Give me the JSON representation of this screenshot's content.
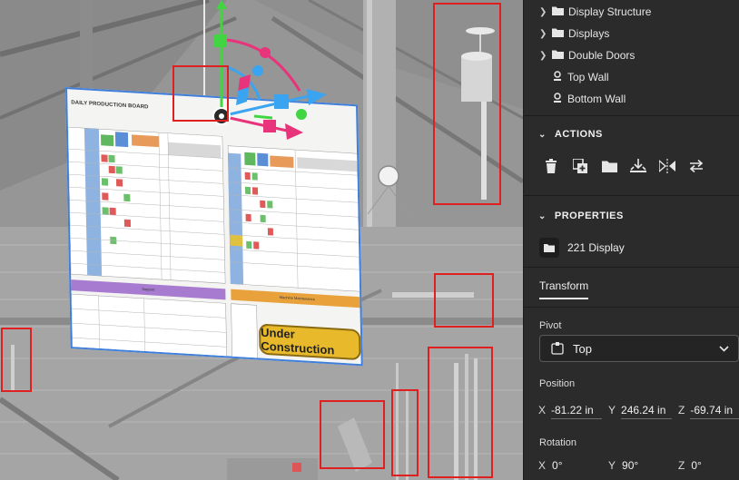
{
  "scene": {
    "board_title": "DAILY PRODUCTION BOARD",
    "support_label": "Support",
    "ops_label": "Machine Maintenance",
    "under_construction": "Under Construction",
    "colors": {
      "board_frame": "#3f7fdc",
      "gizmo_green": "#41d641",
      "gizmo_pink": "#e8347a",
      "gizmo_blue": "#3aa4f0",
      "highlight": "#e02020"
    }
  },
  "panel": {
    "tree": [
      {
        "label": "Display Structure",
        "type": "folder"
      },
      {
        "label": "Displays",
        "type": "folder"
      },
      {
        "label": "Double Doors",
        "type": "folder"
      },
      {
        "label": "Top Wall",
        "type": "model"
      },
      {
        "label": "Bottom Wall",
        "type": "model"
      }
    ],
    "actions": {
      "title": "ACTIONS",
      "buttons": [
        "trash-icon",
        "duplicate-icon",
        "folder-icon",
        "import-icon",
        "flip-icon",
        "swap-icon"
      ]
    },
    "properties": {
      "title": "PROPERTIES",
      "object_name": "221 Display",
      "tab": "Transform",
      "pivot_label": "Pivot",
      "pivot_value": "Top",
      "position_label": "Position",
      "position": {
        "x": "-81.22 in",
        "y": "246.24 in",
        "z": "-69.74 in"
      },
      "rotation_label": "Rotation",
      "rotation": {
        "x": "0°",
        "y": "90°",
        "z": "0°"
      },
      "axis_labels": {
        "x": "X",
        "y": "Y",
        "z": "Z"
      }
    }
  }
}
